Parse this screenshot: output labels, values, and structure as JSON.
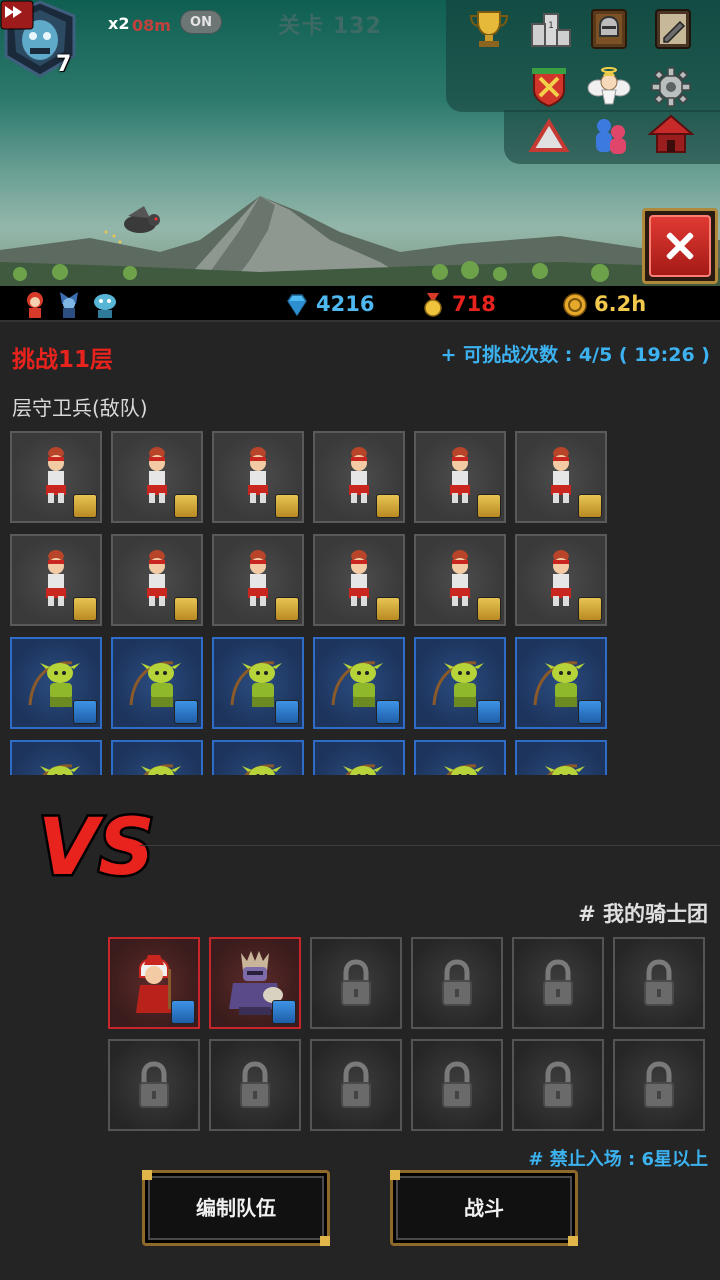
{
  "hud": {
    "boss_level": "7",
    "speed_multiplier": "x2",
    "speed_timer": "08m",
    "auto_toggle": "ON",
    "stage": "关卡 132"
  },
  "menu_icons": [
    "trophy-icon",
    "ranking-podium-icon",
    "knight-helmet-book-icon",
    "quest-book-icon",
    "crossed-swords-shield-icon",
    "angel-icon",
    "gear-icon",
    "triangle-warning-icon",
    "friends-icon",
    "red-house-icon"
  ],
  "resources": {
    "gems": "4216",
    "medals": "718",
    "gold_time": "6.2h"
  },
  "colors": {
    "gems": "#4fb8f0",
    "medals": "#e8231d",
    "gold": "#f2c94c",
    "accent_blue": "#3cb2f0",
    "accent_red": "#e8231d"
  },
  "challenge": {
    "title": "挑战11层",
    "attempts": "+ 可挑战次数 : 4/5 ( 19:26 )"
  },
  "enemy_section": {
    "label": "层守卫兵(敌队)",
    "rows": [
      {
        "type": "warrior",
        "count": 6
      },
      {
        "type": "warrior",
        "count": 6
      },
      {
        "type": "archer",
        "count": 6
      },
      {
        "type": "archer",
        "count": 6
      }
    ]
  },
  "vs": "VS",
  "my_team": {
    "label": "# 我的骑士团",
    "slots": [
      "mage",
      "dark-knight",
      "locked",
      "locked",
      "locked",
      "locked",
      "locked",
      "locked",
      "locked",
      "locked",
      "locked",
      "locked"
    ]
  },
  "restriction": "# 禁止入场 : 6星以上",
  "buttons": {
    "edit_team": "编制队伍",
    "fight": "战斗"
  }
}
